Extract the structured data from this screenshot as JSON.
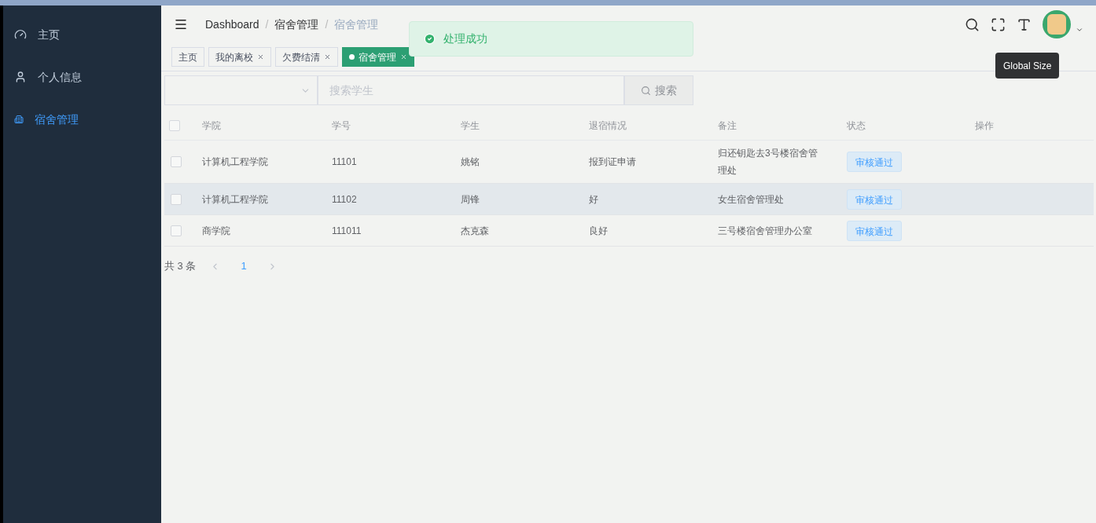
{
  "sidebar": {
    "items": [
      {
        "label": "主页",
        "selected": false
      },
      {
        "label": "个人信息",
        "selected": false
      },
      {
        "label": "宿舍管理",
        "selected": true
      }
    ]
  },
  "breadcrumb": {
    "items": [
      "Dashboard",
      "宿舍管理",
      "宿舍管理"
    ],
    "separators": [
      "/",
      "/"
    ]
  },
  "tags": [
    {
      "label": "主页",
      "closable": false,
      "selected": false
    },
    {
      "label": "我的离校",
      "closable": true,
      "selected": false
    },
    {
      "label": "欠费结清",
      "closable": true,
      "selected": false
    },
    {
      "label": "宿舍管理",
      "closable": true,
      "selected": true
    }
  ],
  "toast": {
    "message": "处理成功"
  },
  "tooltip": "Global Size",
  "search": {
    "placeholder": "搜索学生",
    "button": "搜索"
  },
  "table": {
    "all_checked": false,
    "columns": [
      "学院",
      "学号",
      "学生",
      "退宿情况",
      "备注",
      "状态",
      "操作"
    ],
    "rows": [
      {
        "checked": false,
        "hovered": false,
        "cells": [
          "计算机工程学院",
          "11101",
          "姚铭",
          "报到证申请",
          "归还钥匙去3号楼宿舍管理处"
        ],
        "status": "审核通过"
      },
      {
        "checked": false,
        "hovered": true,
        "cells": [
          "计算机工程学院",
          "11102",
          "周锋",
          "好",
          "女生宿舍管理处"
        ],
        "status": "审核通过"
      },
      {
        "checked": false,
        "hovered": false,
        "cells": [
          "商学院",
          "111011",
          "杰克森",
          "良好",
          "三号楼宿舍管理办公室"
        ],
        "status": "审核通过"
      }
    ]
  },
  "pagination": {
    "total": "共 3 条",
    "pages": [
      {
        "label": "1",
        "selected": true
      }
    ]
  }
}
